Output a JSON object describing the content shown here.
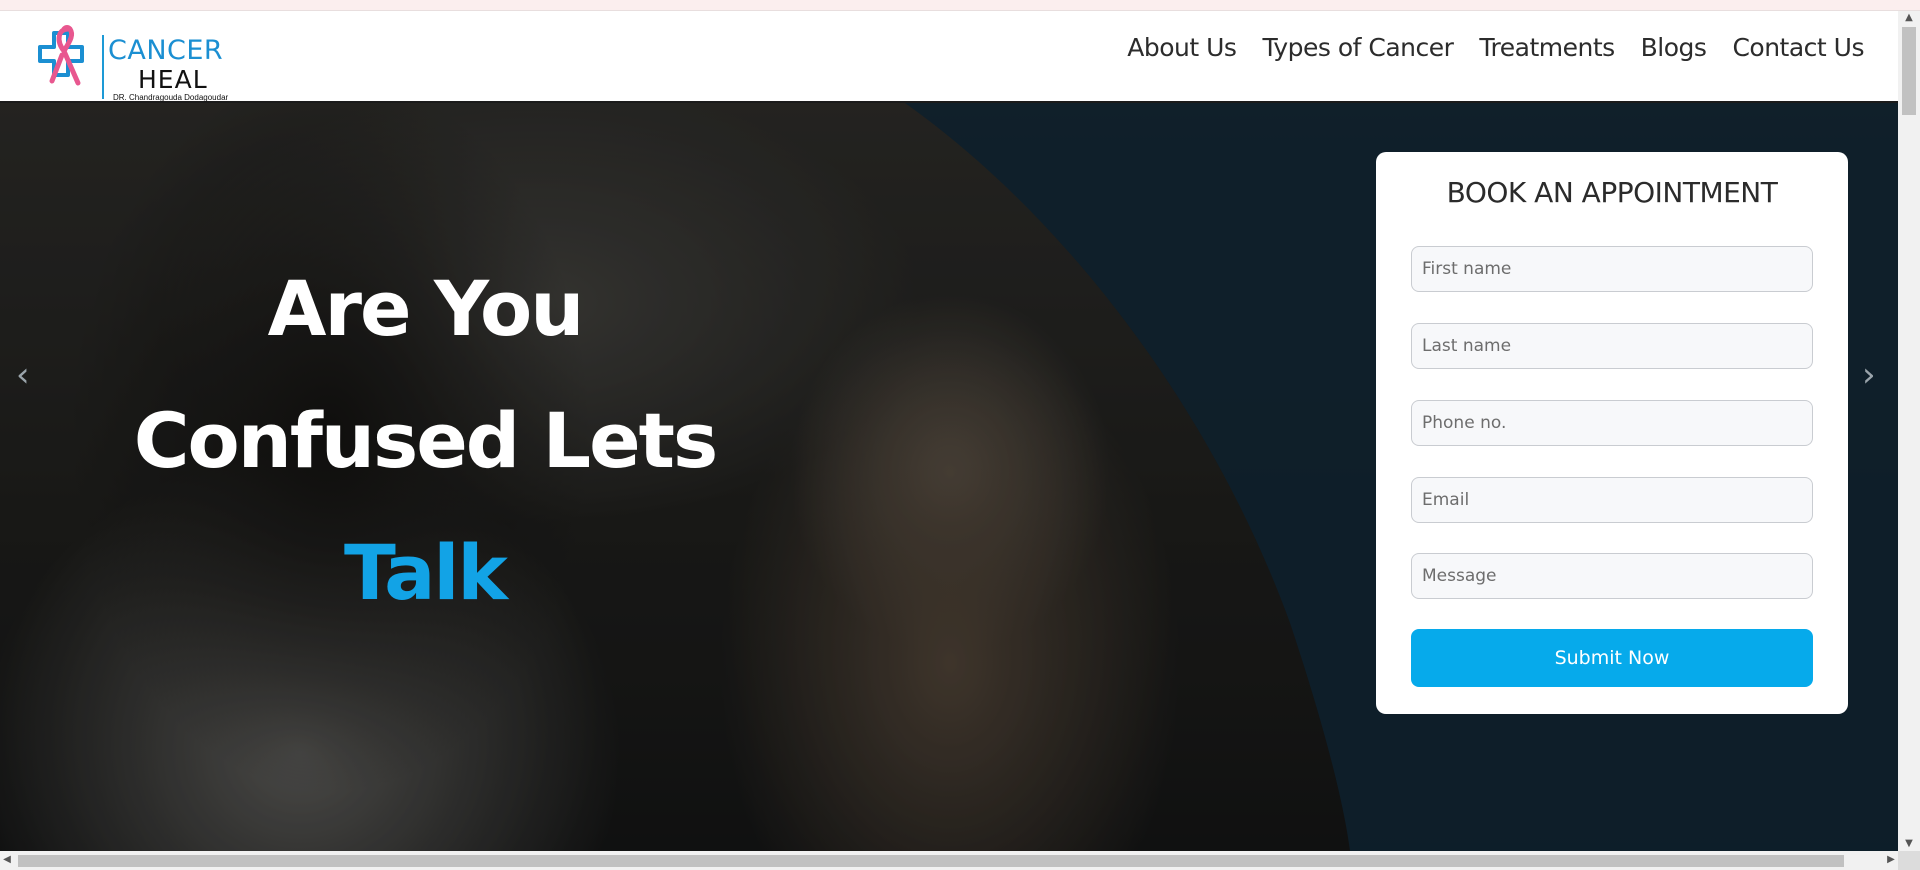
{
  "brand": {
    "word1": "CANCER",
    "word2": "HEAL",
    "subtitle": "DR. Chandragouda Dodagoudar",
    "colors": {
      "blue": "#1b8fd2",
      "ribbon": "#e8578f"
    }
  },
  "nav": {
    "items": [
      {
        "label": "About Us"
      },
      {
        "label": "Types of Cancer"
      },
      {
        "label": "Treatments"
      },
      {
        "label": "Blogs"
      },
      {
        "label": "Contact Us"
      }
    ]
  },
  "hero": {
    "headline_line1": "Are You",
    "headline_line2": "Confused Lets",
    "headline_accent": "Talk",
    "accent_color": "#12a3e6",
    "prev_arrow": "‹",
    "next_arrow": "›"
  },
  "form": {
    "title": "BOOK AN APPOINTMENT",
    "first_name_placeholder": "First name",
    "last_name_placeholder": "Last name",
    "phone_placeholder": "Phone no.",
    "email_placeholder": "Email",
    "message_placeholder": "Message",
    "submit_label": "Submit Now",
    "submit_color": "#06aaeb"
  },
  "icons": {
    "logo": "cross-with-ribbon-logo",
    "prev": "chevron-left-icon",
    "next": "chevron-right-icon"
  }
}
